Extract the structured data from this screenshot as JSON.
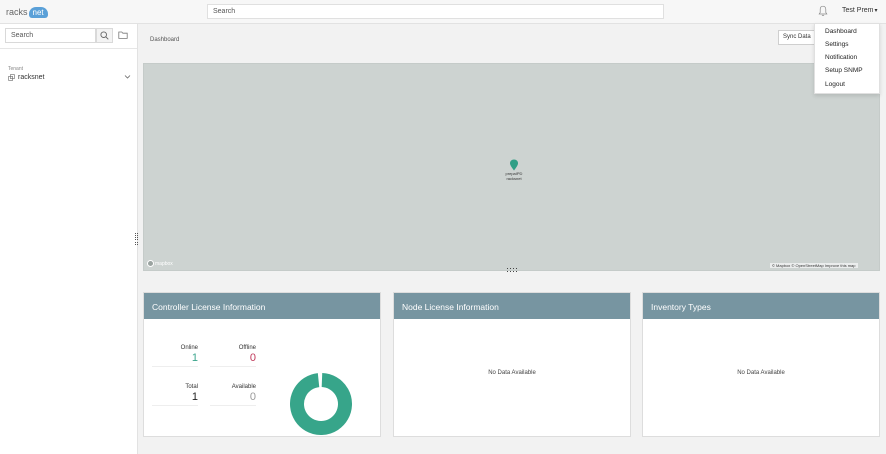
{
  "header": {
    "logo_text": "racks",
    "logo_badge": "net",
    "search_placeholder": "Search",
    "user_name": "Test Prem",
    "caret": "▾"
  },
  "sidebar": {
    "search_placeholder": "Search",
    "tenant_label": "Tenant",
    "tenant_value": "racksnet"
  },
  "main": {
    "breadcrumb": "Dashboard",
    "sync_button": "Sync Data"
  },
  "map": {
    "pin_label_line1": "prepaIPD",
    "pin_label_line2": "racksnet",
    "mapbox_logo": "mapbox",
    "attribution": "© Mapbox © OpenStreetMap Improve this map"
  },
  "cards": {
    "controller": {
      "title": "Controller License Information",
      "stats": [
        {
          "label": "Online",
          "value": "1",
          "color": "#3aa58c"
        },
        {
          "label": "Offline",
          "value": "0",
          "color": "#c0395a"
        },
        {
          "label": "Total",
          "value": "1",
          "color": "#222222"
        },
        {
          "label": "Available",
          "value": "0",
          "color": "#999999"
        }
      ],
      "donut_fraction_online": 0.99,
      "donut_color": "#37a58a"
    },
    "node": {
      "title": "Node License Information",
      "empty_text": "No Data Available"
    },
    "inventory": {
      "title": "Inventory Types",
      "empty_text": "No Data Available"
    }
  },
  "user_menu": {
    "items": [
      "Dashboard",
      "Settings",
      "Notification",
      "Setup SNMP",
      "Logout"
    ]
  },
  "icons": {
    "search": "search-icon",
    "folder": "folder-icon",
    "bell": "bell-icon",
    "tenant": "tenant-icon",
    "chevron": "chevron-down-icon",
    "pin": "map-pin-icon"
  }
}
